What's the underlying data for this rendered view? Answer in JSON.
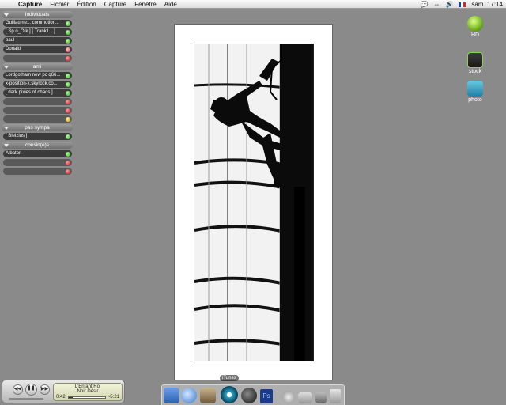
{
  "menubar": {
    "app": "Capture",
    "items": [
      "Fichier",
      "Édition",
      "Capture",
      "Fenêtre",
      "Aide"
    ],
    "clock": "sam. 17:14"
  },
  "buddy_list": {
    "groups": [
      {
        "name": "Individuals",
        "buddies": [
          {
            "label": "Guillaume... commotion...",
            "status": "green"
          },
          {
            "label": "[ Sp.o_O.k ]  [ Trankil... ]",
            "status": "green"
          },
          {
            "label": "paul",
            "status": "green"
          },
          {
            "label": "Donald",
            "status": "pink"
          },
          {
            "label": "",
            "status": "red"
          }
        ]
      },
      {
        "name": "ami",
        "buddies": [
          {
            "label": "Lordgotham new pc q66...",
            "status": "green"
          },
          {
            "label": "x-position-x.skyrock.co...",
            "status": "green"
          },
          {
            "label": "[ dark pixies of chaos ]",
            "status": "green"
          },
          {
            "label": "",
            "status": "red"
          },
          {
            "label": "",
            "status": "red"
          },
          {
            "label": "",
            "status": "yellow"
          }
        ]
      },
      {
        "name": "pas sympa",
        "buddies": [
          {
            "label": "[ Bleizius ]",
            "status": "green"
          }
        ]
      },
      {
        "name": "cousin(e)s",
        "buddies": [
          {
            "label": "Albator",
            "status": "green"
          },
          {
            "label": "",
            "status": "red"
          },
          {
            "label": "",
            "status": "red"
          }
        ]
      }
    ]
  },
  "desktop_icons": [
    {
      "label": "HD",
      "icon": "hard-drive-icon"
    },
    {
      "label": "stock",
      "icon": "folder-stock-icon"
    },
    {
      "label": "photo",
      "icon": "folder-photo-icon"
    }
  ],
  "itunes": {
    "line1": "L'Enfant Roi",
    "line2": "Noir Désir",
    "elapsed": "0:42",
    "remaining": "-5:21",
    "progress": 0.12
  },
  "dock": {
    "tooltip": "iTunes"
  }
}
